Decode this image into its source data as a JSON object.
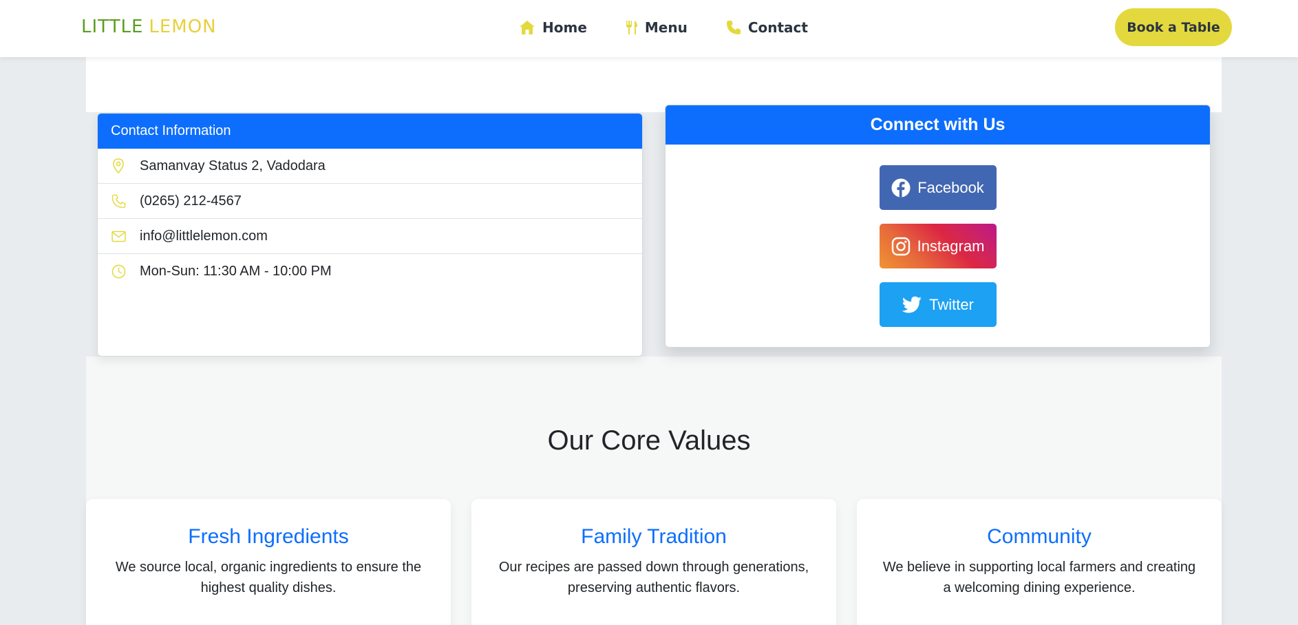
{
  "brand": {
    "logo_part1": "LITTLE",
    "logo_part2": "LEMON"
  },
  "nav": {
    "home": "Home",
    "menu": "Menu",
    "contact": "Contact",
    "book_button": "Book a Table"
  },
  "contact_info": {
    "title": "Contact Information",
    "address": "Samanvay Status 2, Vadodara",
    "phone": "(0265) 212-4567",
    "email": "info@littlelemon.com",
    "hours": "Mon-Sun: 11:30 AM - 10:00 PM"
  },
  "connect": {
    "title": "Connect with Us",
    "facebook": "Facebook",
    "instagram": "Instagram",
    "twitter": "Twitter"
  },
  "core_values": {
    "title": "Our Core Values",
    "cards": [
      {
        "title": "Fresh Ingredients",
        "text": "We source local, organic ingredients to ensure the highest quality dishes."
      },
      {
        "title": "Family Tradition",
        "text": "Our recipes are passed down through generations, preserving authentic flavors."
      },
      {
        "title": "Community",
        "text": "We believe in supporting local farmers and creating a welcoming dining experience."
      }
    ]
  },
  "colors": {
    "primary": "#0d6efd",
    "accent_yellow": "#e3d93e",
    "logo_green": "#5a9e1f",
    "facebook": "#4267b2",
    "twitter": "#1da1f2"
  },
  "icons": {
    "home": "home-icon",
    "menu": "utensils-icon",
    "contact": "phone-icon",
    "address": "map-pin-icon",
    "phone": "phone-icon",
    "email": "envelope-icon",
    "hours": "clock-icon",
    "facebook": "facebook-icon",
    "instagram": "instagram-icon",
    "twitter": "twitter-icon"
  }
}
